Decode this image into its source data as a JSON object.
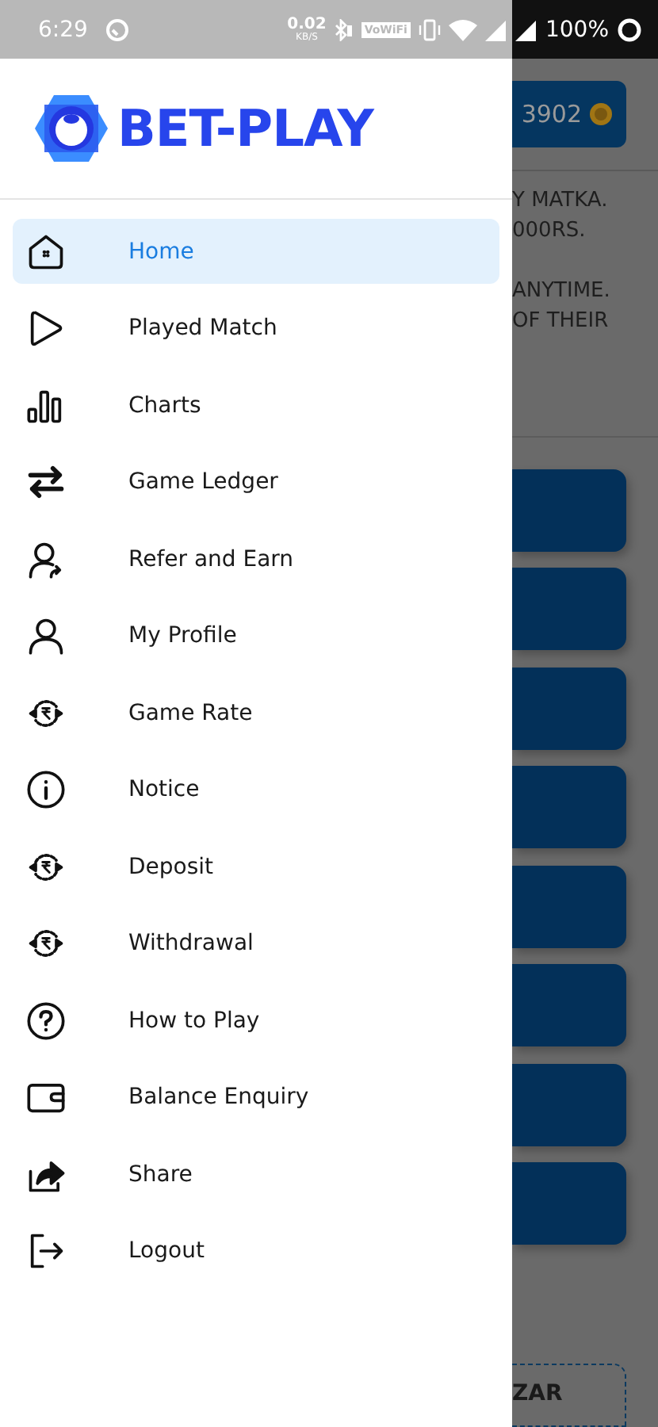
{
  "status_bar": {
    "time": "6:29",
    "net_speed": "0.02",
    "net_unit": "KB/S",
    "wifi_calling": "VoWiFi",
    "battery": "100%"
  },
  "brand": {
    "name": "BET-PLAY"
  },
  "menu": [
    {
      "label": "Home",
      "kind": "home",
      "selected": true
    },
    {
      "label": "Played Match",
      "kind": "play",
      "selected": false
    },
    {
      "label": "Charts",
      "kind": "chart",
      "selected": false
    },
    {
      "label": "Game Ledger",
      "kind": "exchange",
      "selected": false
    },
    {
      "label": "Refer and Earn",
      "kind": "refer",
      "selected": false
    },
    {
      "label": "My Profile",
      "kind": "user",
      "selected": false
    },
    {
      "label": "Game Rate",
      "kind": "rupee",
      "selected": false
    },
    {
      "label": "Notice",
      "kind": "info",
      "selected": false
    },
    {
      "label": "Deposit",
      "kind": "rupee",
      "selected": false
    },
    {
      "label": "Withdrawal",
      "kind": "rupee",
      "selected": false
    },
    {
      "label": "How to Play",
      "kind": "help",
      "selected": false
    },
    {
      "label": "Balance Enquiry",
      "kind": "wallet",
      "selected": false
    },
    {
      "label": "Share",
      "kind": "share",
      "selected": false
    },
    {
      "label": "Logout",
      "kind": "logout",
      "selected": false
    }
  ],
  "background": {
    "balance": "3902",
    "notice_paragraphs": [
      [
        "Y MATKA.",
        "000RS."
      ],
      [
        "ANYTIME.",
        "OF THEIR"
      ]
    ],
    "game_buttons": [
      {
        "kind": "market"
      },
      {
        "kind": "market"
      },
      {
        "kind": "market"
      },
      {
        "kind": "market"
      },
      {
        "kind": "market"
      },
      {
        "kind": "market"
      },
      {
        "kind": "market"
      },
      {
        "kind": "market"
      }
    ],
    "bottom_button": "ZAR"
  }
}
